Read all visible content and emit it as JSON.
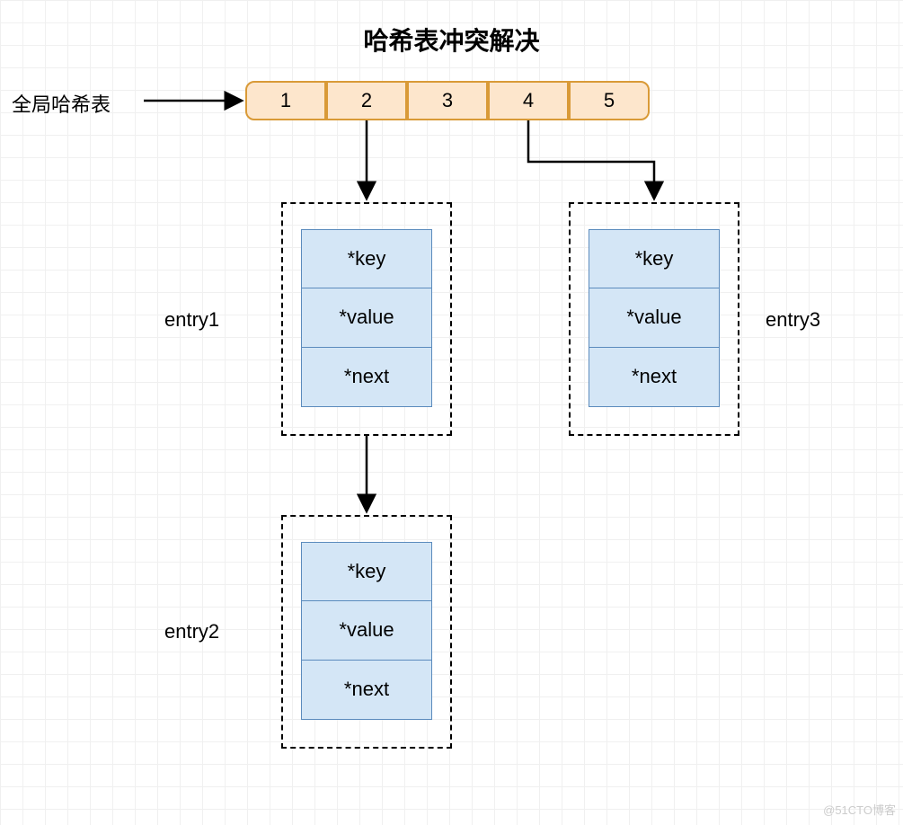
{
  "title": "哈希表冲突解决",
  "global_label": "全局哈希表",
  "buckets": [
    "1",
    "2",
    "3",
    "4",
    "5"
  ],
  "entries": {
    "e1": {
      "label": "entry1",
      "key": "*key",
      "value": "*value",
      "next": "*next"
    },
    "e2": {
      "label": "entry2",
      "key": "*key",
      "value": "*value",
      "next": "*next"
    },
    "e3": {
      "label": "entry3",
      "key": "*key",
      "value": "*value",
      "next": "*next"
    }
  },
  "watermark": "@51CTO博客"
}
